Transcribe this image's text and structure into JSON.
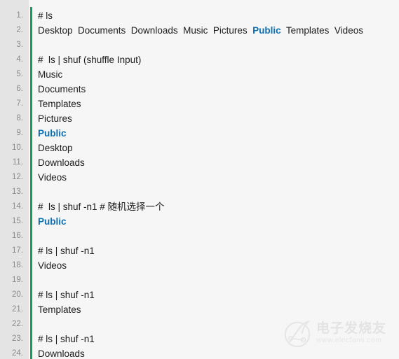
{
  "editor": {
    "language_hint": "shell",
    "accent_color": "#10a05a",
    "gutter_color": "#e4e4e4",
    "background_color": "#f6f6f6",
    "text_color": "#1c1c1c",
    "highlight_color": "#0b6fb5",
    "line_number_color": "#8a8a8a",
    "lines": [
      {
        "number": "1.",
        "segments": [
          {
            "text": "# ls",
            "highlight": false
          }
        ]
      },
      {
        "number": "2.",
        "segments": [
          {
            "text": "Desktop  Documents  Downloads  Music  Pictures  ",
            "highlight": false
          },
          {
            "text": "Public",
            "highlight": true
          },
          {
            "text": "  Templates  Videos",
            "highlight": false
          }
        ]
      },
      {
        "number": "3.",
        "segments": [
          {
            "text": "",
            "highlight": false
          }
        ]
      },
      {
        "number": "4.",
        "segments": [
          {
            "text": "#  ls | shuf (shuffle Input)",
            "highlight": false
          }
        ]
      },
      {
        "number": "5.",
        "segments": [
          {
            "text": "Music",
            "highlight": false
          }
        ]
      },
      {
        "number": "6.",
        "segments": [
          {
            "text": "Documents",
            "highlight": false
          }
        ]
      },
      {
        "number": "7.",
        "segments": [
          {
            "text": "Templates",
            "highlight": false
          }
        ]
      },
      {
        "number": "8.",
        "segments": [
          {
            "text": "Pictures",
            "highlight": false
          }
        ]
      },
      {
        "number": "9.",
        "segments": [
          {
            "text": "Public",
            "highlight": true
          }
        ]
      },
      {
        "number": "10.",
        "segments": [
          {
            "text": "Desktop",
            "highlight": false
          }
        ]
      },
      {
        "number": "11.",
        "segments": [
          {
            "text": "Downloads",
            "highlight": false
          }
        ]
      },
      {
        "number": "12.",
        "segments": [
          {
            "text": "Videos",
            "highlight": false
          }
        ]
      },
      {
        "number": "13.",
        "segments": [
          {
            "text": "",
            "highlight": false
          }
        ]
      },
      {
        "number": "14.",
        "segments": [
          {
            "text": "#  ls | shuf -n1 # 随机选择一个",
            "highlight": false
          }
        ]
      },
      {
        "number": "15.",
        "segments": [
          {
            "text": "Public",
            "highlight": true
          }
        ]
      },
      {
        "number": "16.",
        "segments": [
          {
            "text": "",
            "highlight": false
          }
        ]
      },
      {
        "number": "17.",
        "segments": [
          {
            "text": "# ls | shuf -n1",
            "highlight": false
          }
        ]
      },
      {
        "number": "18.",
        "segments": [
          {
            "text": "Videos",
            "highlight": false
          }
        ]
      },
      {
        "number": "19.",
        "segments": [
          {
            "text": "",
            "highlight": false
          }
        ]
      },
      {
        "number": "20.",
        "segments": [
          {
            "text": "# ls | shuf -n1",
            "highlight": false
          }
        ]
      },
      {
        "number": "21.",
        "segments": [
          {
            "text": "Templates",
            "highlight": false
          }
        ]
      },
      {
        "number": "22.",
        "segments": [
          {
            "text": "",
            "highlight": false
          }
        ]
      },
      {
        "number": "23.",
        "segments": [
          {
            "text": "# ls | shuf -n1",
            "highlight": false
          }
        ]
      },
      {
        "number": "24.",
        "segments": [
          {
            "text": "Downloads",
            "highlight": false
          }
        ]
      }
    ]
  },
  "watermark": {
    "brand_cn": "电子发烧友",
    "url": "www.elecfans.com"
  }
}
